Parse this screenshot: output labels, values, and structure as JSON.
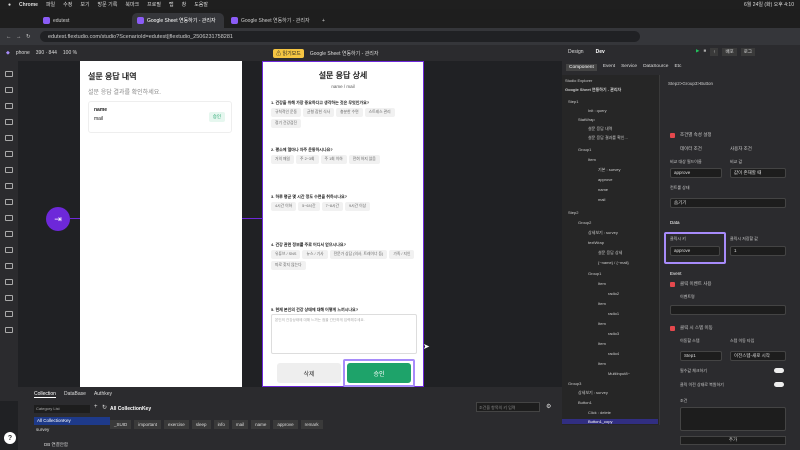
{
  "mac": {
    "app": "Chrome",
    "menus": [
      "파일",
      "수정",
      "보기",
      "방문 기록",
      "북마크",
      "프로필",
      "탭",
      "창",
      "도움말"
    ],
    "clock": "6월 24일 (화) 오후 4:10"
  },
  "tabs": [
    {
      "label": "edutest"
    },
    {
      "label": "Google Sheet 연동하기 - 관리자"
    },
    {
      "label": "Google Sheet 연동하기 - 관리자"
    }
  ],
  "address": "edutest.flextudio.com/studio?ScenarioId=edutest||flextudio_2506231758281",
  "toolbar": {
    "device": "phone",
    "size": "390 · 844",
    "zoom": "100 %",
    "badge": "⚠ 읽기모드",
    "title": "Google Sheet 연동하기 - 관리자"
  },
  "screen1": {
    "title": "설문 응답 내역",
    "subtitle": "설문 응답 결과를 확인하세요.",
    "card": {
      "name": "name",
      "mail": "mail",
      "button": "승인"
    }
  },
  "screen2": {
    "title": "설문 응답 상세",
    "subtitle": "name / mail",
    "questions": [
      {
        "q": "1. 건강을 위해 가장 중요하다고 생각하는 것은 무엇인가요?",
        "options": [
          "규칙적인 운동",
          "균형 잡힌 식사",
          "충분한 수면",
          "스트레스 관리",
          "정기 건강검진"
        ]
      },
      {
        "q": "2. 평소에 얼마나 자주 운동하시나요?",
        "options": [
          "거의 매일",
          "주 2~3회",
          "주 1회 이하",
          "전혀 하지 않음"
        ]
      },
      {
        "q": "3. 하루 평균 몇 시간 정도 수면을 취하시나요?",
        "options": [
          "4시간 이하",
          "5~6시간",
          "7~8시간",
          "9시간 이상"
        ]
      },
      {
        "q": "4. 건강 관련 정보를 주로 어디서 얻으시나요?",
        "options": [
          "유튜브 / SNS",
          "뉴스 / 기사",
          "전문가 상담 (의사, 트레이너 등)",
          "가족 / 지인",
          "따로 찾지 않는다"
        ]
      },
      {
        "q": "5. 현재 본인의 건강 상태에 대해 어떻게 느끼시나요?",
        "options": []
      }
    ],
    "textarea_placeholder": "본인의 건강상태에 대해 느끼는 점을 간단하게 입력해주세요.",
    "delete": "삭제",
    "approve": "승인"
  },
  "bottom": {
    "tabs": [
      "Collection",
      "DataBase",
      "Authkey"
    ],
    "category": "Category List",
    "all": "All CollectionKey",
    "item": "survey",
    "header": "All CollectionKey",
    "search_placeholder": "조건을 항목의 키 입력",
    "keys": [
      "_SUID",
      "important",
      "exercise",
      "sleep",
      "info",
      "mail",
      "name",
      "approve",
      "remark"
    ],
    "db": "DB 연결안함"
  },
  "right": {
    "tabs": [
      "Design",
      "Dev"
    ],
    "subtabs": [
      "Component",
      "Event",
      "Service",
      "DataSource",
      "Etc"
    ],
    "buttons": [
      "↑",
      "배포",
      "로그"
    ],
    "explorer_title": "Studio Explorer",
    "project": "Google Sheet 연동하기 - 관리자",
    "tree": [
      "Step1",
      "Init : query",
      "StatWrap",
      "설문 응답 내역",
      "설문 응답 결과를 확인...",
      "Group1",
      "Item",
      "기본 : survey",
      "approve",
      "name",
      "mail",
      "Step2",
      "Group2",
      "상세보기 : survey",
      "textWrap",
      "설문 응답 상세",
      "{~name} / {~mail}",
      "Group1",
      "Item",
      "radio2",
      "Item",
      "radio1",
      "Item",
      "radio3",
      "Item",
      "radio4",
      "Item",
      "MultiInput8~",
      "Group3",
      "상세보기 : survey",
      "Button1",
      "Click : delete",
      "Button1_copy"
    ],
    "path": "Step2>Group3>Button",
    "cond": "조건별 속성 설정",
    "cond_radio": [
      "데이터 조건",
      "사용자 조건"
    ],
    "compare_label": "비교 대상 필드이름",
    "compare_value_label": "비교 값",
    "compare_field": "approve",
    "compare_value": "값이 존재할 때",
    "target_label": "컨트롤 상태",
    "target": "숨기기",
    "data_section": "Data",
    "click_key_label": "클릭시 키",
    "click_key": "approve",
    "click_save_label": "클릭시 저장할 값",
    "click_save": "1",
    "event_section": "Event",
    "use_click": "클릭 이벤트 사용",
    "event_name": "이벤트명",
    "move_step": "클릭 시 스텝 이동",
    "step_move": "이동할 스텝",
    "step_type": "스텝 이동 타입",
    "step": "Step1",
    "step_type_value": "이전스텝-새로 시작",
    "check_required": "필수값 체크하기",
    "reset_state": "클릭 이전 상태로 복원하기",
    "condition": "조건",
    "add": "추가"
  }
}
